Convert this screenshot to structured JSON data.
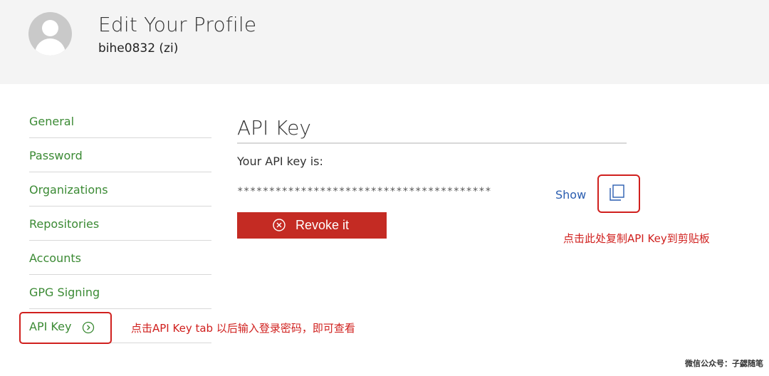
{
  "header": {
    "title": "Edit Your Profile",
    "username": "bihe0832 (zi)"
  },
  "sidebar": {
    "items": [
      {
        "label": "General"
      },
      {
        "label": "Password"
      },
      {
        "label": "Organizations"
      },
      {
        "label": "Repositories"
      },
      {
        "label": "Accounts"
      },
      {
        "label": "GPG Signing"
      },
      {
        "label": "API Key"
      }
    ]
  },
  "main": {
    "section_title": "API Key",
    "api_key_label": "Your API key is:",
    "api_key_masked": "****************************************",
    "show_label": "Show",
    "revoke_label": "Revoke it"
  },
  "annotations": {
    "copy_note": "点击此处复制API Key到剪贴板",
    "tab_note": "点击API  Key tab 以后输入登录密码，即可查看"
  },
  "watermark": "微信公众号：子勰随笔",
  "colors": {
    "link_green": "#3b8a34",
    "accent_red": "#c42b23",
    "annotation_red": "#d0201e",
    "show_blue": "#2a5db0"
  }
}
